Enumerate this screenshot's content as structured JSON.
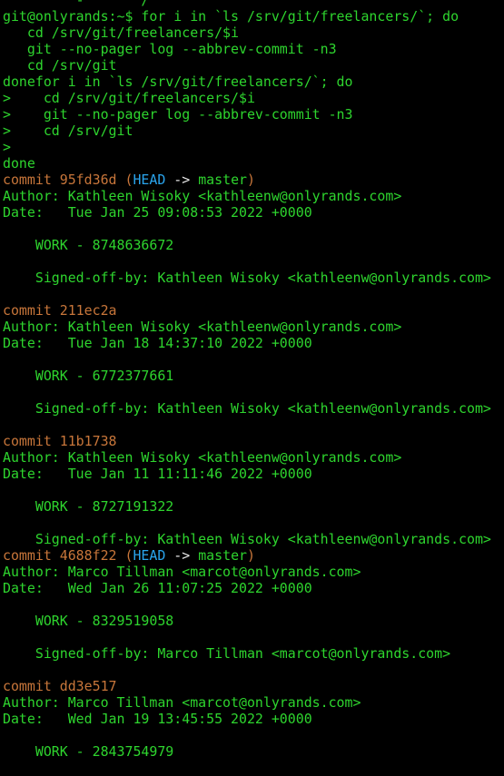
{
  "colors": {
    "background": "#000000",
    "text": "#2ed52e",
    "commit_hash": "#c8763a",
    "head": "#2aa5ee",
    "arrow": "#e6e6e6"
  },
  "terminal": {
    "lines": [
      [
        {
          "t": "         -       /      ",
          "c": "green"
        }
      ],
      [
        {
          "t": "git@onlyrands:~$ for i in `ls /srv/git/freelancers/`; do",
          "c": "green"
        }
      ],
      [
        {
          "t": "   cd /srv/git/freelancers/$i",
          "c": "green"
        }
      ],
      [
        {
          "t": "   git --no-pager log --abbrev-commit -n3",
          "c": "green"
        }
      ],
      [
        {
          "t": "   cd /srv/git",
          "c": "green"
        }
      ],
      [
        {
          "t": "donefor i in `ls /srv/git/freelancers/`; do",
          "c": "green"
        }
      ],
      [
        {
          "t": ">    cd /srv/git/freelancers/$i",
          "c": "green"
        }
      ],
      [
        {
          "t": ">    git --no-pager log --abbrev-commit -n3",
          "c": "green"
        }
      ],
      [
        {
          "t": ">    cd /srv/git",
          "c": "green"
        }
      ],
      [
        {
          "t": ">",
          "c": "green"
        }
      ],
      [
        {
          "t": "done",
          "c": "green"
        }
      ],
      [
        {
          "t": "commit 95fd36d (",
          "c": "orange"
        },
        {
          "t": "HEAD",
          "c": "cyan"
        },
        {
          "t": " -> ",
          "c": "white"
        },
        {
          "t": "master",
          "c": "green"
        },
        {
          "t": ")",
          "c": "orange"
        }
      ],
      [
        {
          "t": "Author: Kathleen Wisoky <kathleenw@onlyrands.com>",
          "c": "green"
        }
      ],
      [
        {
          "t": "Date:   Tue Jan 25 09:08:53 2022 +0000",
          "c": "green"
        }
      ],
      [
        {
          "t": "",
          "c": "green"
        }
      ],
      [
        {
          "t": "    WORK - 8748636672",
          "c": "green"
        }
      ],
      [
        {
          "t": "",
          "c": "green"
        }
      ],
      [
        {
          "t": "    Signed-off-by: Kathleen Wisoky <kathleenw@onlyrands.com>",
          "c": "green"
        }
      ],
      [
        {
          "t": "",
          "c": "green"
        }
      ],
      [
        {
          "t": "commit 211ec2a",
          "c": "orange"
        }
      ],
      [
        {
          "t": "Author: Kathleen Wisoky <kathleenw@onlyrands.com>",
          "c": "green"
        }
      ],
      [
        {
          "t": "Date:   Tue Jan 18 14:37:10 2022 +0000",
          "c": "green"
        }
      ],
      [
        {
          "t": "",
          "c": "green"
        }
      ],
      [
        {
          "t": "    WORK - 6772377661",
          "c": "green"
        }
      ],
      [
        {
          "t": "",
          "c": "green"
        }
      ],
      [
        {
          "t": "    Signed-off-by: Kathleen Wisoky <kathleenw@onlyrands.com>",
          "c": "green"
        }
      ],
      [
        {
          "t": "",
          "c": "green"
        }
      ],
      [
        {
          "t": "commit 11b1738",
          "c": "orange"
        }
      ],
      [
        {
          "t": "Author: Kathleen Wisoky <kathleenw@onlyrands.com>",
          "c": "green"
        }
      ],
      [
        {
          "t": "Date:   Tue Jan 11 11:11:46 2022 +0000",
          "c": "green"
        }
      ],
      [
        {
          "t": "",
          "c": "green"
        }
      ],
      [
        {
          "t": "    WORK - 8727191322",
          "c": "green"
        }
      ],
      [
        {
          "t": "",
          "c": "green"
        }
      ],
      [
        {
          "t": "    Signed-off-by: Kathleen Wisoky <kathleenw@onlyrands.com>",
          "c": "green"
        }
      ],
      [
        {
          "t": "commit 4688f22 (",
          "c": "orange"
        },
        {
          "t": "HEAD",
          "c": "cyan"
        },
        {
          "t": " -> ",
          "c": "white"
        },
        {
          "t": "master",
          "c": "green"
        },
        {
          "t": ")",
          "c": "orange"
        }
      ],
      [
        {
          "t": "Author: Marco Tillman <marcot@onlyrands.com>",
          "c": "green"
        }
      ],
      [
        {
          "t": "Date:   Wed Jan 26 11:07:25 2022 +0000",
          "c": "green"
        }
      ],
      [
        {
          "t": "",
          "c": "green"
        }
      ],
      [
        {
          "t": "    WORK - 8329519058",
          "c": "green"
        }
      ],
      [
        {
          "t": "",
          "c": "green"
        }
      ],
      [
        {
          "t": "    Signed-off-by: Marco Tillman <marcot@onlyrands.com>",
          "c": "green"
        }
      ],
      [
        {
          "t": "",
          "c": "green"
        }
      ],
      [
        {
          "t": "commit dd3e517",
          "c": "orange"
        }
      ],
      [
        {
          "t": "Author: Marco Tillman <marcot@onlyrands.com>",
          "c": "green"
        }
      ],
      [
        {
          "t": "Date:   Wed Jan 19 13:45:55 2022 +0000",
          "c": "green"
        }
      ],
      [
        {
          "t": "",
          "c": "green"
        }
      ],
      [
        {
          "t": "    WORK - 2843754979",
          "c": "green"
        }
      ],
      [
        {
          "t": "",
          "c": "green"
        }
      ]
    ]
  }
}
